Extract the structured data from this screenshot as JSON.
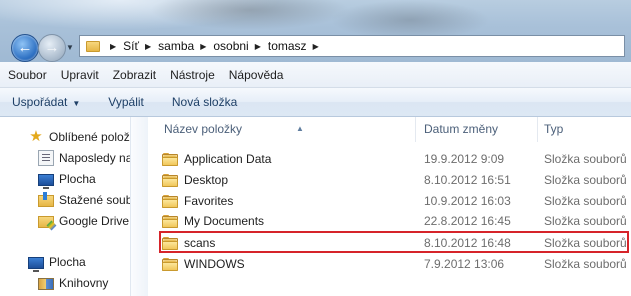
{
  "address": {
    "breadcrumbs": [
      "Síť",
      "samba",
      "osobni",
      "tomasz"
    ]
  },
  "menu": [
    "Soubor",
    "Upravit",
    "Zobrazit",
    "Nástroje",
    "Nápověda"
  ],
  "toolbar": {
    "organize": "Uspořádat",
    "burn": "Vypálit",
    "new_folder": "Nová složka"
  },
  "nav": {
    "favorites_header": "Oblíbené polož",
    "items": [
      {
        "label": "Naposledy na",
        "icon": "recent-places-icon"
      },
      {
        "label": "Plocha",
        "icon": "desktop-icon"
      },
      {
        "label": "Stažené soub",
        "icon": "downloads-icon"
      },
      {
        "label": "Google Drive",
        "icon": "google-drive-icon"
      }
    ],
    "desktop_root": "Plocha",
    "libraries": "Knihovny"
  },
  "columns": {
    "name": "Název položky",
    "date": "Datum změny",
    "type": "Typ"
  },
  "files": [
    {
      "name": "Application Data",
      "date": "19.9.2012 9:09",
      "type": "Složka souborů"
    },
    {
      "name": "Desktop",
      "date": "8.10.2012 16:51",
      "type": "Složka souborů"
    },
    {
      "name": "Favorites",
      "date": "10.9.2012 16:03",
      "type": "Složka souborů"
    },
    {
      "name": "My Documents",
      "date": "22.8.2012 16:45",
      "type": "Složka souborů"
    },
    {
      "name": "scans",
      "date": "8.10.2012 16:48",
      "type": "Složka souborů"
    },
    {
      "name": "WINDOWS",
      "date": "7.9.2012 13:06",
      "type": "Složka souborů"
    }
  ],
  "highlight_color": "#d6242a"
}
